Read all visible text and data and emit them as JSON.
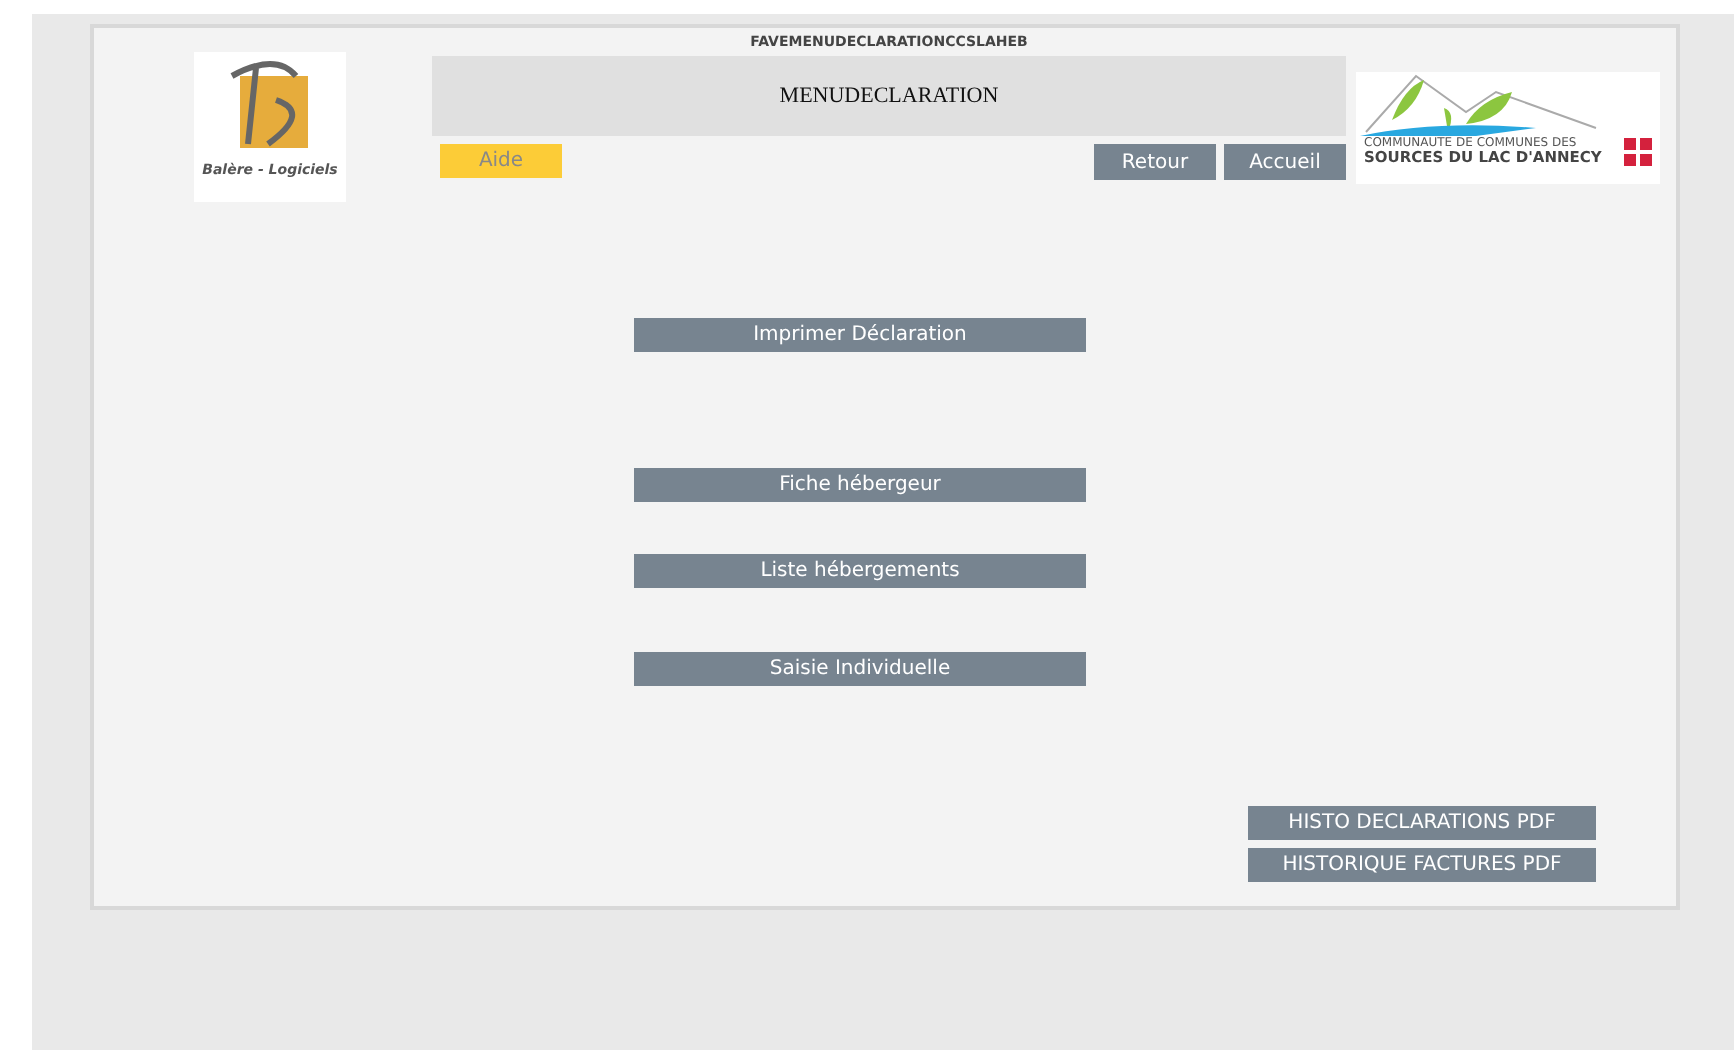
{
  "window": {
    "title": "FAVEMENUDECLARATIONCCSLAHEB"
  },
  "header": {
    "title": "MENUDECLARATION",
    "left_logo": {
      "caption": "Balère - Logiciels"
    },
    "right_logo": {
      "line_1": "COMMUNAUTE DE COMMUNES DES",
      "line_2": "SOURCES DU LAC D'ANNECY"
    }
  },
  "toolbar": {
    "help": "Aide",
    "buttons": [
      "Retour",
      "Accueil"
    ]
  },
  "menu": [
    "Imprimer Déclaration",
    "Fiche hébergeur",
    "Liste hébergements",
    "Saisie Individuelle"
  ],
  "history_buttons": [
    "HISTO DECLARATIONS PDF",
    "HISTORIQUE FACTURES PDF"
  ]
}
